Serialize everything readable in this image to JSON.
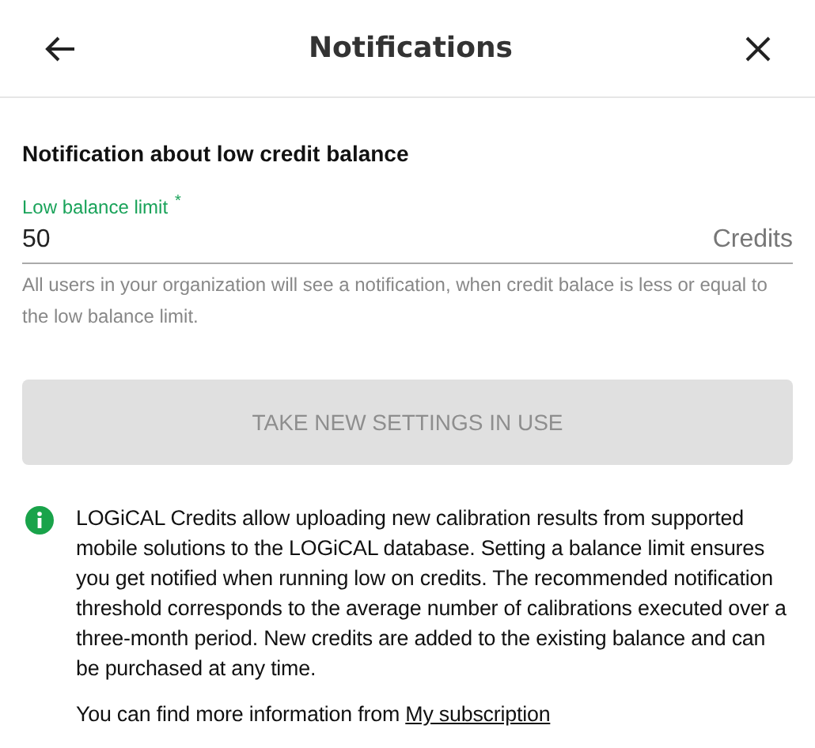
{
  "header": {
    "title": "Notifications"
  },
  "section": {
    "title": "Notification about low credit balance"
  },
  "field": {
    "label": "Low balance limit",
    "required_mark": "*",
    "value": "50",
    "suffix": "Credits",
    "helper": "All users in your organization will see a notification, when credit balace is less or equal to the low balance limit."
  },
  "button": {
    "label": "TAKE NEW SETTINGS IN USE",
    "disabled": true
  },
  "info": {
    "text": "LOGiCAL Credits allow uploading new calibration results from supported mobile solutions to the LOGiCAL database. Setting a balance limit ensures you get notified when running low on credits. The recommended notification threshold corresponds to the average number of calibrations executed over a three-month period. New credits are added to the existing balance and can be purchased at any time.",
    "more": "You can find more information from",
    "link": "My subscription"
  }
}
